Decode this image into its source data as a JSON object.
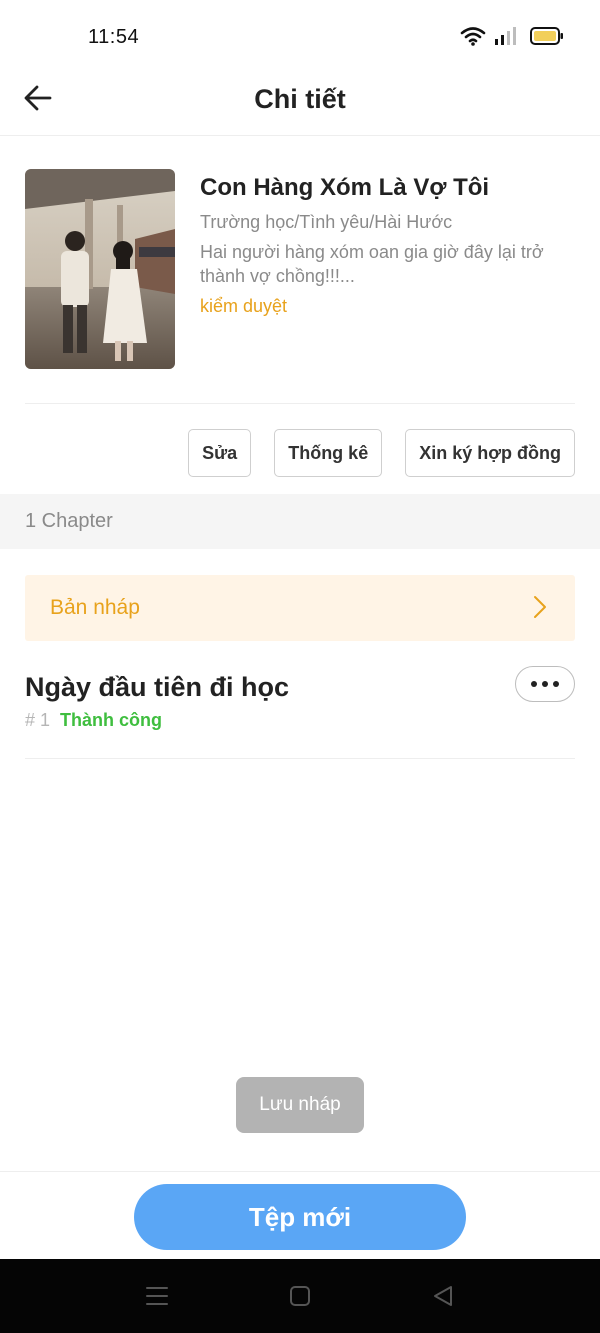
{
  "status_bar": {
    "time": "11:54",
    "icons": [
      "wifi-icon",
      "signal-icon",
      "battery-icon"
    ],
    "battery_color": "#f2cf5a"
  },
  "header": {
    "title": "Chi tiết",
    "back_icon": "arrow-left-icon"
  },
  "book": {
    "title": "Con Hàng Xóm Là Vợ Tôi",
    "genres": "Trường học/Tình yêu/Hài Hước",
    "description": "Hai người hàng xóm oan gia giờ đây lại trở thành vợ chồng!!!...",
    "status": "kiểm duyệt"
  },
  "actions": {
    "edit": "Sửa",
    "stats": "Thống kê",
    "contract": "Xin ký hợp đồng"
  },
  "chapters": {
    "count_label": "1 Chapter",
    "draft_label": "Bản nháp",
    "items": [
      {
        "title": "Ngày đầu tiên đi học",
        "number": "# 1",
        "state": "Thành công"
      }
    ]
  },
  "toast": {
    "text": "Lưu nháp"
  },
  "bottom": {
    "new_button": "Tệp mới"
  },
  "nav": {
    "icons": [
      "menu-icon",
      "home-square-icon",
      "back-triangle-icon"
    ]
  },
  "colors": {
    "accent_orange": "#e8a21c",
    "success_green": "#3fbe3f",
    "primary_blue": "#5aa6f5",
    "draft_bg": "#fff4e6"
  }
}
